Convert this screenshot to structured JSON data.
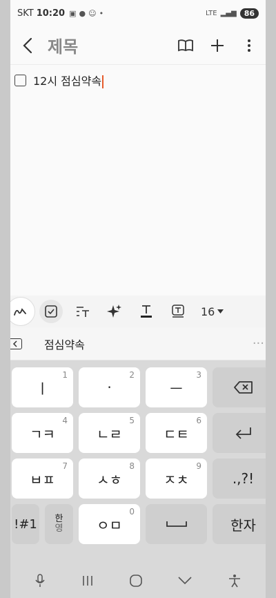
{
  "status": {
    "carrier": "SKT",
    "time": "10:20",
    "network": "LTE",
    "battery": "86"
  },
  "appbar": {
    "title": "제목"
  },
  "note": {
    "item_text": "12시 점심약속"
  },
  "toolbar": {
    "font_size": "16"
  },
  "suggestion": {
    "word": "점심약속",
    "more": "···"
  },
  "keyboard": {
    "rows": [
      [
        {
          "label": "ㅣ",
          "num": "1"
        },
        {
          "label": "·",
          "num": "2"
        },
        {
          "label": "ㅡ",
          "num": "3"
        }
      ],
      [
        {
          "label": "ㄱㅋ",
          "num": "4"
        },
        {
          "label": "ㄴㄹ",
          "num": "5"
        },
        {
          "label": "ㄷㅌ",
          "num": "6"
        }
      ],
      [
        {
          "label": "ㅂㅍ",
          "num": "7"
        },
        {
          "label": "ㅅㅎ",
          "num": "8"
        },
        {
          "label": "ㅈㅊ",
          "num": "9"
        }
      ]
    ],
    "punct": ".,?!",
    "symbols": "!#1",
    "lang_top": "한",
    "lang_bottom": "영",
    "bottom_center": {
      "label": "ㅇㅁ",
      "num": "0"
    },
    "hanja": "한자"
  }
}
